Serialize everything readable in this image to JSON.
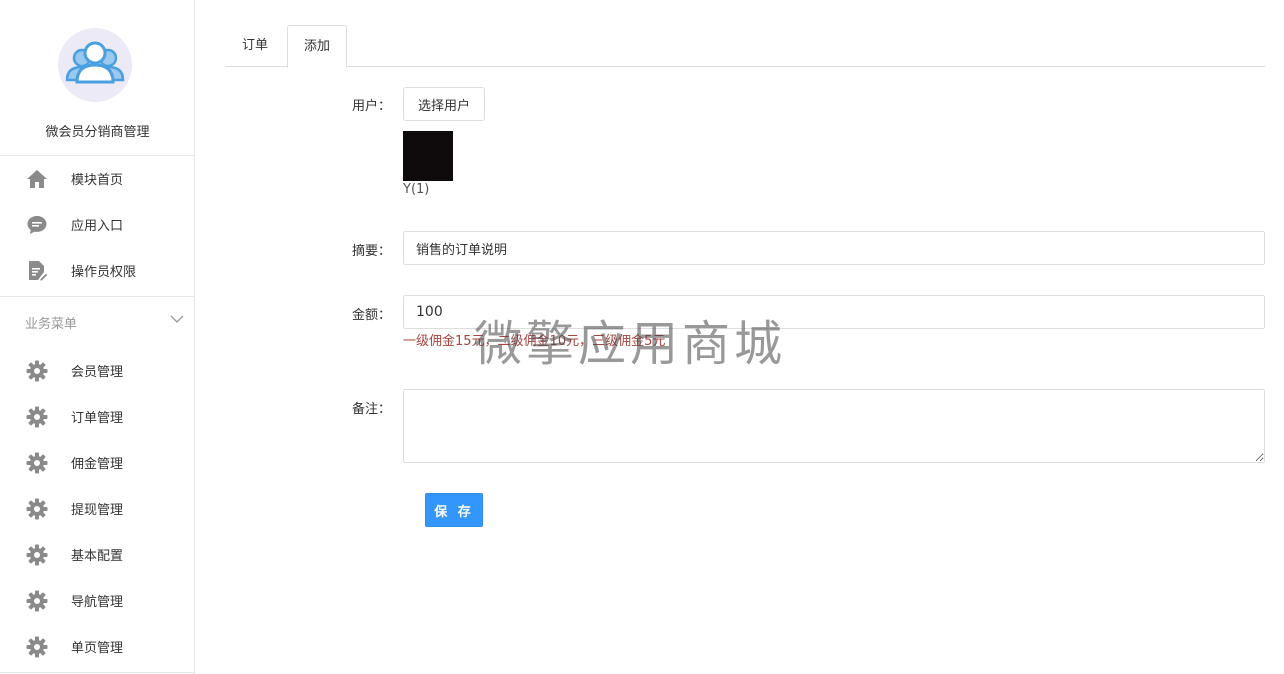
{
  "sidebar": {
    "app_name": "微会员分销商管理",
    "avatar_icon": "users-group-icon",
    "top_items": [
      {
        "label": "模块首页",
        "icon": "home-icon"
      },
      {
        "label": "应用入口",
        "icon": "chat-bubble-icon"
      },
      {
        "label": "操作员权限",
        "icon": "document-edit-icon"
      }
    ],
    "section_title": "业务菜单",
    "business_items": [
      {
        "label": "会员管理",
        "icon": "gear-icon"
      },
      {
        "label": "订单管理",
        "icon": "gear-icon"
      },
      {
        "label": "佣金管理",
        "icon": "gear-icon"
      },
      {
        "label": "提现管理",
        "icon": "gear-icon"
      },
      {
        "label": "基本配置",
        "icon": "gear-icon"
      },
      {
        "label": "导航管理",
        "icon": "gear-icon"
      },
      {
        "label": "单页管理",
        "icon": "gear-icon"
      }
    ]
  },
  "tabs": [
    {
      "label": "订单",
      "active": false
    },
    {
      "label": "添加",
      "active": true
    }
  ],
  "form": {
    "user_label": "用户：",
    "select_user_button": "选择用户",
    "selected_user_name": "Y(1)",
    "summary_label": "摘要：",
    "summary_value": "销售的订单说明",
    "amount_label": "金额：",
    "amount_value": "100",
    "commission_hint": "一级佣金15元，二级佣金10元，三级佣金5元",
    "remark_label": "备注：",
    "remark_value": "",
    "save_button": "保 存"
  },
  "watermark": "微擎应用商城",
  "colors": {
    "primary": "#3296fa",
    "hint_text": "#a94442",
    "sidebar_icon": "#8a8a8a",
    "avatar_blue": "#4a9fe0"
  }
}
